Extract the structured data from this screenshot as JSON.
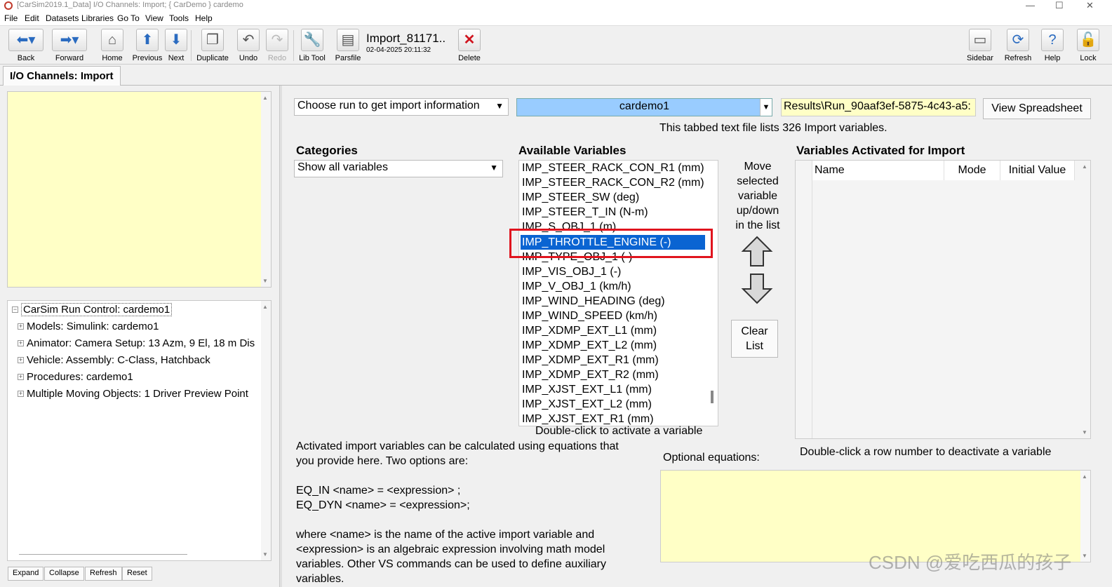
{
  "window": {
    "title": "[CarSim2019.1_Data] I/O Channels: Import; { CarDemo } cardemo",
    "minimize": "—",
    "maximize": "☐",
    "close": "✕"
  },
  "menu": [
    "File",
    "Edit",
    "Datasets",
    "Libraries",
    "Go To",
    "View",
    "Tools",
    "Help"
  ],
  "toolbar": {
    "back": "Back",
    "forward": "Forward",
    "home": "Home",
    "previous": "Previous",
    "next": "Next",
    "duplicate": "Duplicate",
    "undo": "Undo",
    "redo": "Redo",
    "lib_tool": "Lib Tool",
    "parsfile": "Parsfile",
    "dataset_name": "Import_81171..",
    "dataset_date": "02-04-2025 20:11:32",
    "delete": "Delete",
    "sidebar": "Sidebar",
    "refresh": "Refresh",
    "help": "Help",
    "lock": "Lock"
  },
  "tab": {
    "label": "I/O Channels: Import"
  },
  "tree": {
    "items": [
      "CarSim Run Control: cardemo1",
      "Models: Simulink: cardemo1",
      "Animator: Camera Setup: 13 Azm, 9 El, 18 m Dis",
      "Vehicle: Assembly: C-Class, Hatchback",
      "Procedures: cardemo1",
      "Multiple Moving Objects: 1 Driver Preview Point"
    ]
  },
  "left_buttons": {
    "expand": "Expand",
    "collapse": "Collapse",
    "refresh": "Refresh",
    "reset": "Reset"
  },
  "main": {
    "run_dropdown": "Choose run to get import information",
    "run_selected": "cardemo1",
    "results_path": "Results\\Run_90aaf3ef-5875-4c43-a5:",
    "view_spreadsheet": "View Spreadsheet",
    "file_info": "This tabbed text file lists 326 Import variables.",
    "categories_heading": "Categories",
    "categories_value": "Show all variables",
    "available_heading": "Available Variables",
    "available_variables": [
      "IMP_STEER_RACK_CON_R1 (mm)",
      "IMP_STEER_RACK_CON_R2 (mm)",
      "IMP_STEER_SW (deg)",
      "IMP_STEER_T_IN (N-m)",
      "IMP_S_OBJ_1 (m)",
      "IMP_THROTTLE_ENGINE (-)",
      "IMP_TYPE_OBJ_1 (-)",
      "IMP_VIS_OBJ_1 (-)",
      "IMP_V_OBJ_1 (km/h)",
      "IMP_WIND_HEADING (deg)",
      "IMP_WIND_SPEED (km/h)",
      "IMP_XDMP_EXT_L1 (mm)",
      "IMP_XDMP_EXT_L2 (mm)",
      "IMP_XDMP_EXT_R1 (mm)",
      "IMP_XDMP_EXT_R2 (mm)",
      "IMP_XJST_EXT_L1 (mm)",
      "IMP_XJST_EXT_L2 (mm)",
      "IMP_XJST_EXT_R1 (mm)"
    ],
    "selected_variable": "IMP_THROTTLE_ENGINE (-)",
    "double_click_activate": "Double-click to activate a variable",
    "move_text": [
      "Move",
      "selected",
      "variable",
      "up/down",
      "in the list"
    ],
    "clear_list": [
      "Clear",
      "List"
    ],
    "activated_heading": "Variables Activated for Import",
    "activated_columns": {
      "name": "Name",
      "mode": "Mode",
      "initial": "Initial Value"
    },
    "double_click_deactivate": "Double-click a row number to deactivate a variable",
    "optional_equations": "Optional equations:",
    "help_text": [
      "Activated import variables can be calculated using equations that",
      "you provide here. Two options are:",
      "",
      "EQ_IN <name> = <expression> ;",
      "EQ_DYN <name> = <expression>;",
      "",
      "where <name> is the name of the active import variable and",
      "<expression> is an algebraic expression involving math model",
      "variables. Other VS commands can be used to define auxiliary",
      "variables."
    ]
  },
  "watermark": "CSDN @爱吃西瓜的孩子",
  "colors": {
    "accent_blue": "#99ccff",
    "note_yellow": "#ffffc6",
    "selection": "#0a64d2",
    "highlight_red": "#e0141e"
  }
}
